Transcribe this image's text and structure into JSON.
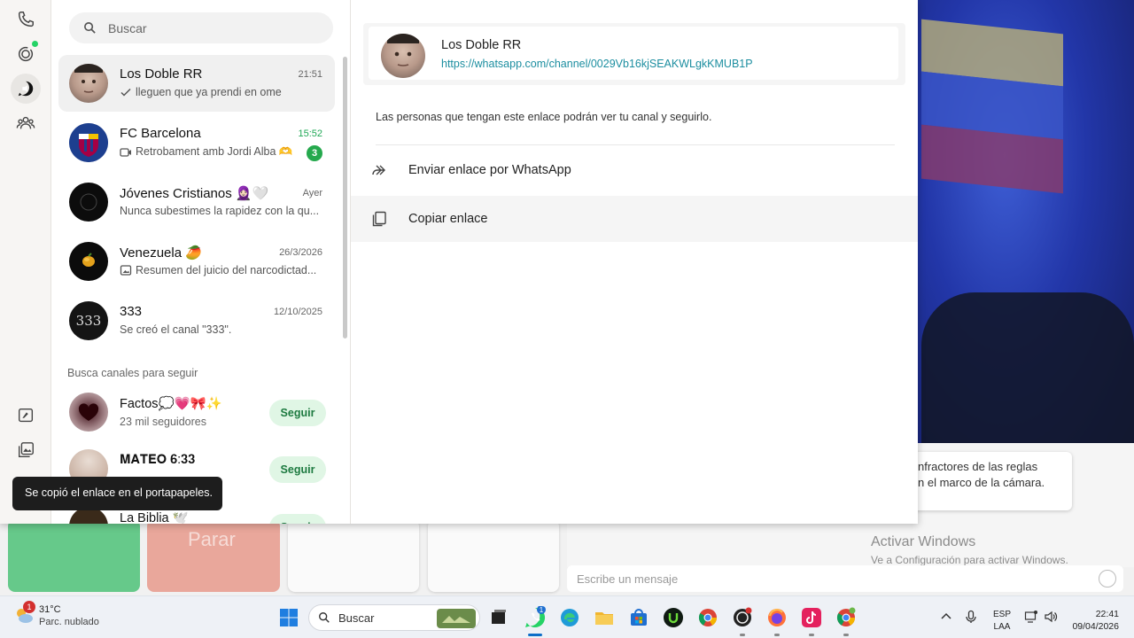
{
  "colors": {
    "accent_green": "#25d366",
    "link_teal": "#1c8ea0",
    "badge_green": "#25a94d"
  },
  "rail": {
    "items": [
      {
        "name": "calls-icon"
      },
      {
        "name": "status-icon"
      },
      {
        "name": "channels-icon",
        "active": true
      },
      {
        "name": "communities-icon"
      }
    ],
    "bottom": [
      {
        "name": "starred-icon"
      },
      {
        "name": "media-icon"
      }
    ]
  },
  "search": {
    "placeholder": "Buscar"
  },
  "chats": [
    {
      "name": "Los Doble RR",
      "time": "21:51",
      "last": "lleguen que ya prendi en ome",
      "prefix": "check-icon"
    },
    {
      "name": "FC Barcelona",
      "time": "15:52",
      "last": "Retrobament amb Jordi Alba 🫶",
      "prefix": "video-icon",
      "unread": "3"
    },
    {
      "name": "Jóvenes Cristianos 🧕🏻🤍",
      "time": "Ayer",
      "last": "Nunca subestimes la rapidez con la qu..."
    },
    {
      "name": "Venezuela 🥭",
      "time": "26/3/2026",
      "last": "Resumen del juicio del narcodictad...",
      "prefix": "image-icon"
    },
    {
      "name": "333",
      "time": "12/10/2025",
      "last": "Se creó el canal \"333\"."
    }
  ],
  "suggestions": {
    "title": "Busca canales para seguir",
    "items": [
      {
        "name": "Factos💭💗🎀✨",
        "sub": "23 mil seguidores",
        "button": "Seguir"
      },
      {
        "name": "𝐌𝐀𝐓𝐄𝐎 𝟔:𝟑𝟑",
        "sub": "",
        "button": "Seguir"
      },
      {
        "name": "La Biblia 🕊️",
        "sub": "",
        "button": "Seguir"
      }
    ]
  },
  "toast": "Se copió el enlace en el portapapeles.",
  "detail": {
    "channel_name": "Los Doble RR",
    "channel_url": "https://whatsapp.com/channel/0029Vb16kjSEAKWLgkKMUB1P",
    "description": "Las personas que tengan este enlace podrán ver tu canal y seguirlo.",
    "actions": [
      {
        "label": "Enviar enlace por WhatsApp",
        "icon": "forward-icon"
      },
      {
        "label": "Copiar enlace",
        "icon": "copy-icon"
      }
    ]
  },
  "background": {
    "pad_label": "Parar",
    "warning_line1": "nfractores de las reglas",
    "warning_line2": "n el marco de la cámara.",
    "activate_title": "Activar Windows",
    "activate_sub": "Ve a Configuración para activar Windows.",
    "message_placeholder": "Escribe un mensaje"
  },
  "taskbar": {
    "temp": "31°C",
    "weather": "Parc. nublado",
    "weather_badge": "1",
    "search_label": "Buscar",
    "whatsapp_badge": "1",
    "lang1": "ESP",
    "lang2": "LAA",
    "time": "22:41",
    "date": "09/04/2026"
  }
}
